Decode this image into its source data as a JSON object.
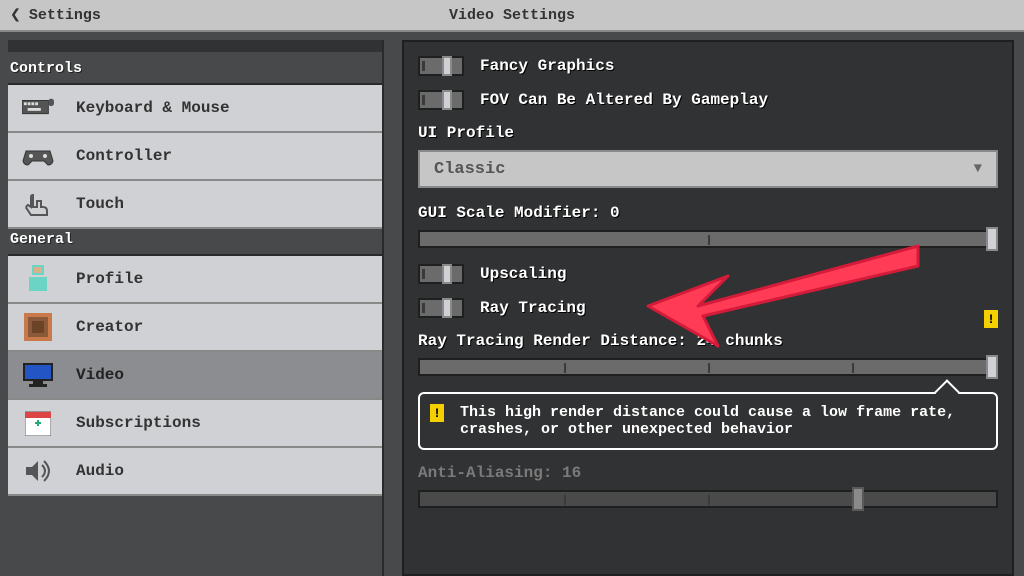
{
  "header": {
    "back_label": "Settings",
    "title": "Video Settings"
  },
  "sidebar": {
    "sections": {
      "controls_label": "Controls",
      "general_label": "General"
    },
    "items": [
      {
        "label": "Keyboard & Mouse",
        "icon": "keyboard-icon"
      },
      {
        "label": "Controller",
        "icon": "gamepad-icon"
      },
      {
        "label": "Touch",
        "icon": "touch-icon"
      },
      {
        "label": "Profile",
        "icon": "profile-icon"
      },
      {
        "label": "Creator",
        "icon": "creator-icon"
      },
      {
        "label": "Video",
        "icon": "monitor-icon"
      },
      {
        "label": "Subscriptions",
        "icon": "calendar-plus-icon"
      },
      {
        "label": "Audio",
        "icon": "speaker-icon"
      }
    ]
  },
  "panel": {
    "toggles": {
      "fancy_graphics": "Fancy Graphics",
      "fov_altered": "FOV Can Be Altered By Gameplay",
      "upscaling": "Upscaling",
      "ray_tracing": "Ray Tracing"
    },
    "ui_profile": {
      "label": "UI Profile",
      "value": "Classic"
    },
    "gui_scale": {
      "label": "GUI Scale Modifier: 0",
      "value": 0
    },
    "rt_distance": {
      "label": "Ray Tracing Render Distance: 24 chunks",
      "value": 24
    },
    "warning": "This high render distance could cause a low frame rate, crashes, or other unexpected behavior",
    "anti_aliasing": {
      "label": "Anti-Aliasing: 16",
      "value": 16
    }
  }
}
